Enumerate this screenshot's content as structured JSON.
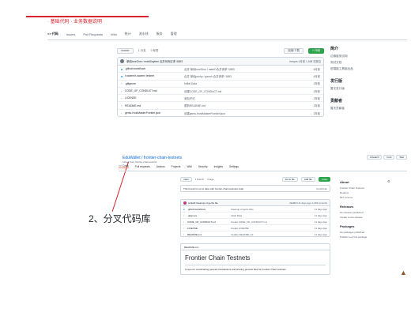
{
  "top": {
    "title": "· 基础代码 · 业务数据说明",
    "tabs": [
      "<> 代码",
      "Issues",
      "Pull Requests",
      "Wiki",
      "统计",
      "流水线",
      "服务",
      "管理"
    ],
    "toolbar": {
      "branch": "master",
      "branches": "1 分支",
      "tags": "0 标签",
      "clone_btn": "克隆/下载",
      "green_btn": "+ 代码"
    },
    "commit": {
      "text": "单纯loveGine / markDaytem 合并代码请求 !1883",
      "meta": "hexyes 4月前  1,168 次提交"
    },
    "files": [
      {
        "icon": "folder",
        "name": ".github/workflows",
        "msg": "合并 单纯loveGine / markD合并请求 !1883",
        "time": "4月前"
      },
      {
        "icon": "folder",
        "name": "t-swarm/t-swarm/ testnet",
        "msg": "合并 单纯pochy / gaonh 合并请求 !1883",
        "time": "4月前"
      },
      {
        "icon": "file",
        "name": ".gitignore",
        "msg": "Initial Data",
        "time": "1年前"
      },
      {
        "icon": "file",
        "name": "CODE_OF_CONDUCT.md",
        "msg": "创建CODE_OF_CONDUCT.md",
        "time": "1年前"
      },
      {
        "icon": "file",
        "name": "LICENSE",
        "msg": "添加许可",
        "time": "1年前"
      },
      {
        "icon": "file",
        "name": "README.md",
        "msg": "更新README.md",
        "time": "1年前"
      },
      {
        "icon": "file",
        "name": "genis-HostMasterFrontier.json",
        "msg": "创建genis-HostMasterFrontier.json",
        "time": "1年前"
      }
    ],
    "about": {
      "title": "简介",
      "lines": [
        "边缘链测试网",
        "测试文档",
        "前端链工具组出品"
      ],
      "title2": "发行版",
      "lines2": [
        "暂无发行版"
      ],
      "title3": "贡献者",
      "lines3": [
        "暂无贡献者"
      ]
    }
  },
  "annotation": {
    "label": "2、分叉代码库"
  },
  "github": {
    "repo": "EduWallet / frontier-chain-testnets",
    "forked_from": "forked from frontier-chain-testnet",
    "actions": [
      "Unwatch",
      "Fork",
      "Star"
    ],
    "tabs": [
      "<> Code",
      "Pull requests",
      "Actions",
      "Projects",
      "Wiki",
      "Security",
      "Insights",
      "Settings"
    ],
    "branchbar": {
      "branch": "main",
      "branches": "1 branch",
      "tags": "0 tags",
      "goto": "Go to file",
      "addfile": "Add file",
      "code": "Code"
    },
    "ahead": {
      "left": "This branch is up to date with frontier-chain-testnets:main.",
      "right": "Contribute"
    },
    "commit": {
      "text": "wink30  Cleanup of gerbs file",
      "meta": "c9a8bf4 11 days ago  1,168 commits"
    },
    "files": [
      {
        "icon": "folder",
        "name": ".github/workflows",
        "msg": "Cleanup of genis files",
        "time": "11 days ago"
      },
      {
        "icon": "file",
        "name": ".gitignore",
        "msg": "Initial Data",
        "time": "11 days ago"
      },
      {
        "icon": "file",
        "name": "CODE_OF_CONDUCT.md",
        "msg": "Create CODE_OF_CONDUCT.md",
        "time": "11 days ago"
      },
      {
        "icon": "file",
        "name": "LICENSE",
        "msg": "Create LICENSE",
        "time": "11 days ago"
      },
      {
        "icon": "file",
        "name": "README.md",
        "msg": "Update README.md",
        "time": "11 days ago"
      }
    ],
    "readme": {
      "head": "README.md",
      "title": "Frontier Chain Testnets",
      "desc": "A repo for coordinating genesis transactions and sharing genesis files for Frontier Chain testnets"
    },
    "about": {
      "title": "About",
      "desc": "Frontier Chain Testnets",
      "lines": [
        "Readme",
        "MIT License"
      ],
      "releases_title": "Releases",
      "releases": [
        "No releases published",
        "Create a new release"
      ],
      "packages_title": "Packages",
      "packages": [
        "No packages published",
        "Publish your first package"
      ]
    }
  }
}
